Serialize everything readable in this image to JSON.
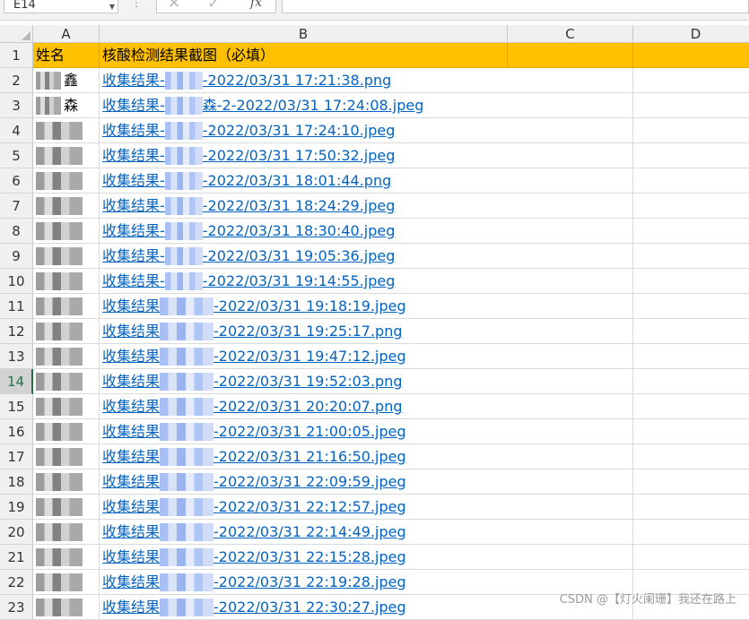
{
  "formula_bar": {
    "name_box": "E14",
    "fx_label": "fx",
    "formula": ""
  },
  "columns": [
    "A",
    "B",
    "C",
    "D"
  ],
  "header_row": {
    "row_number": "1",
    "name_header": "姓名",
    "result_header": "核酸检测结果截图（必填）"
  },
  "rows": [
    {
      "n": "2",
      "name_tail": "鑫",
      "file": "收集结果-",
      "file_tail": "-2022/03/31 17:21:38.png"
    },
    {
      "n": "3",
      "name_tail": "森",
      "file": "收集结果-",
      "file_tail": "森-2-2022/03/31 17:24:08.jpeg"
    },
    {
      "n": "4",
      "name_tail": "",
      "file": "收集结果-",
      "file_tail": "-2022/03/31 17:24:10.jpeg"
    },
    {
      "n": "5",
      "name_tail": "",
      "file": "收集结果-",
      "file_tail": "-2022/03/31 17:50:32.jpeg"
    },
    {
      "n": "6",
      "name_tail": "",
      "file": "收集结果-",
      "file_tail": "-2022/03/31 18:01:44.png"
    },
    {
      "n": "7",
      "name_tail": "",
      "file": "收集结果-",
      "file_tail": "-2022/03/31 18:24:29.jpeg"
    },
    {
      "n": "8",
      "name_tail": "",
      "file": "收集结果-",
      "file_tail": "-2022/03/31 18:30:40.jpeg"
    },
    {
      "n": "9",
      "name_tail": "",
      "file": "收集结果-",
      "file_tail": "-2022/03/31 19:05:36.jpeg"
    },
    {
      "n": "10",
      "name_tail": "",
      "file": "收集结果-",
      "file_tail": "-2022/03/31 19:14:55.jpeg"
    },
    {
      "n": "11",
      "name_tail": "",
      "file": "收集结果",
      "file_tail": "-2022/03/31 19:18:19.jpeg"
    },
    {
      "n": "12",
      "name_tail": "",
      "file": "收集结果",
      "file_tail": "-2022/03/31 19:25:17.png"
    },
    {
      "n": "13",
      "name_tail": "",
      "file": "收集结果",
      "file_tail": "-2022/03/31 19:47:12.jpeg"
    },
    {
      "n": "14",
      "name_tail": "",
      "file": "收集结果",
      "file_tail": "-2022/03/31 19:52:03.png",
      "active": true
    },
    {
      "n": "15",
      "name_tail": "",
      "file": "收集结果",
      "file_tail": "-2022/03/31 20:20:07.png"
    },
    {
      "n": "16",
      "name_tail": "",
      "file": "收集结果",
      "file_tail": "-2022/03/31 21:00:05.jpeg"
    },
    {
      "n": "17",
      "name_tail": "",
      "file": "收集结果",
      "file_tail": "-2022/03/31 21:16:50.jpeg"
    },
    {
      "n": "18",
      "name_tail": "",
      "file": "收集结果",
      "file_tail": "-2022/03/31 22:09:59.jpeg"
    },
    {
      "n": "19",
      "name_tail": "",
      "file": "收集结果",
      "file_tail": "-2022/03/31 22:12:57.jpeg"
    },
    {
      "n": "20",
      "name_tail": "",
      "file": "收集结果",
      "file_tail": "-2022/03/31 22:14:49.jpeg"
    },
    {
      "n": "21",
      "name_tail": "",
      "file": "收集结果",
      "file_tail": "-2022/03/31 22:15:28.jpeg"
    },
    {
      "n": "22",
      "name_tail": "",
      "file": "收集结果",
      "file_tail": "-2022/03/31 22:19:28.jpeg"
    },
    {
      "n": "23",
      "name_tail": "",
      "file": "收集结果",
      "file_tail": "-2022/03/31 22:30:27.jpeg"
    }
  ],
  "watermark": "CSDN @【灯火阑珊】我还在路上",
  "colors": {
    "header_fill": "#ffc000",
    "link": "#0563c1",
    "active_row": "#217346"
  }
}
